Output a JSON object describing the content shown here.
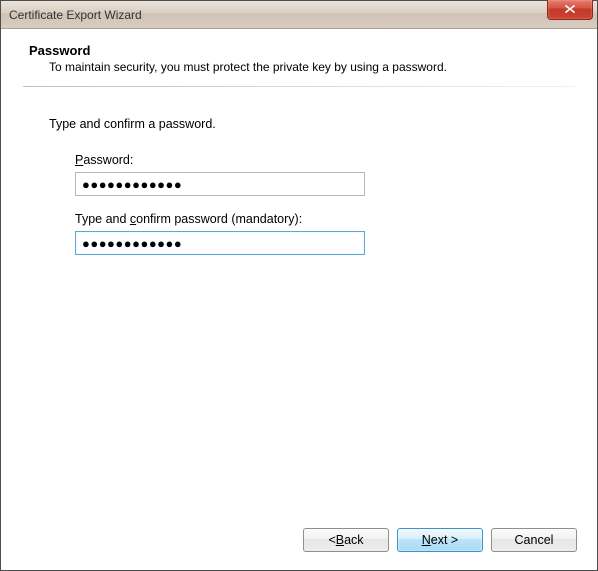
{
  "window": {
    "title": "Certificate Export Wizard"
  },
  "page": {
    "heading": "Password",
    "subheading": "To maintain security, you must protect the private key by using a password.",
    "instruction": "Type and confirm a password."
  },
  "fields": {
    "password": {
      "label_pre": "",
      "label_u": "P",
      "label_post": "assword:",
      "value": "●●●●●●●●●●●●"
    },
    "confirm": {
      "label_pre": "Type and ",
      "label_u": "c",
      "label_post": "onfirm password (mandatory):",
      "value": "●●●●●●●●●●●●"
    }
  },
  "buttons": {
    "back_pre": "< ",
    "back_u": "B",
    "back_post": "ack",
    "next_u": "N",
    "next_post": "ext >",
    "cancel": "Cancel"
  }
}
